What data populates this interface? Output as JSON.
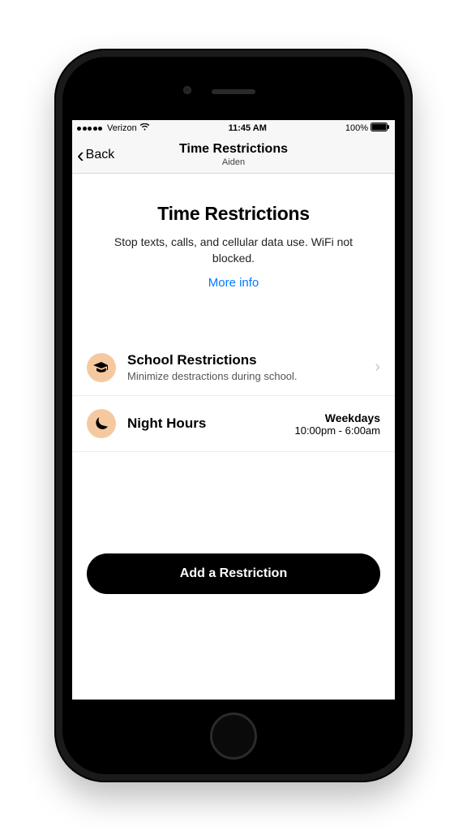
{
  "status": {
    "carrier": "Verizon",
    "time": "11:45 AM",
    "battery": "100%"
  },
  "nav": {
    "back_label": "Back",
    "title": "Time Restrictions",
    "subtitle": "Aiden"
  },
  "hero": {
    "title": "Time Restrictions",
    "body": "Stop texts, calls, and cellular data use. WiFi not blocked.",
    "more": "More info"
  },
  "rows": {
    "school": {
      "title": "School Restrictions",
      "subtitle": "Minimize destractions during school."
    },
    "night": {
      "title": "Night Hours",
      "right_top": "Weekdays",
      "right_bottom": "10:00pm - 6:00am"
    }
  },
  "cta": {
    "label": "Add a Restriction"
  }
}
